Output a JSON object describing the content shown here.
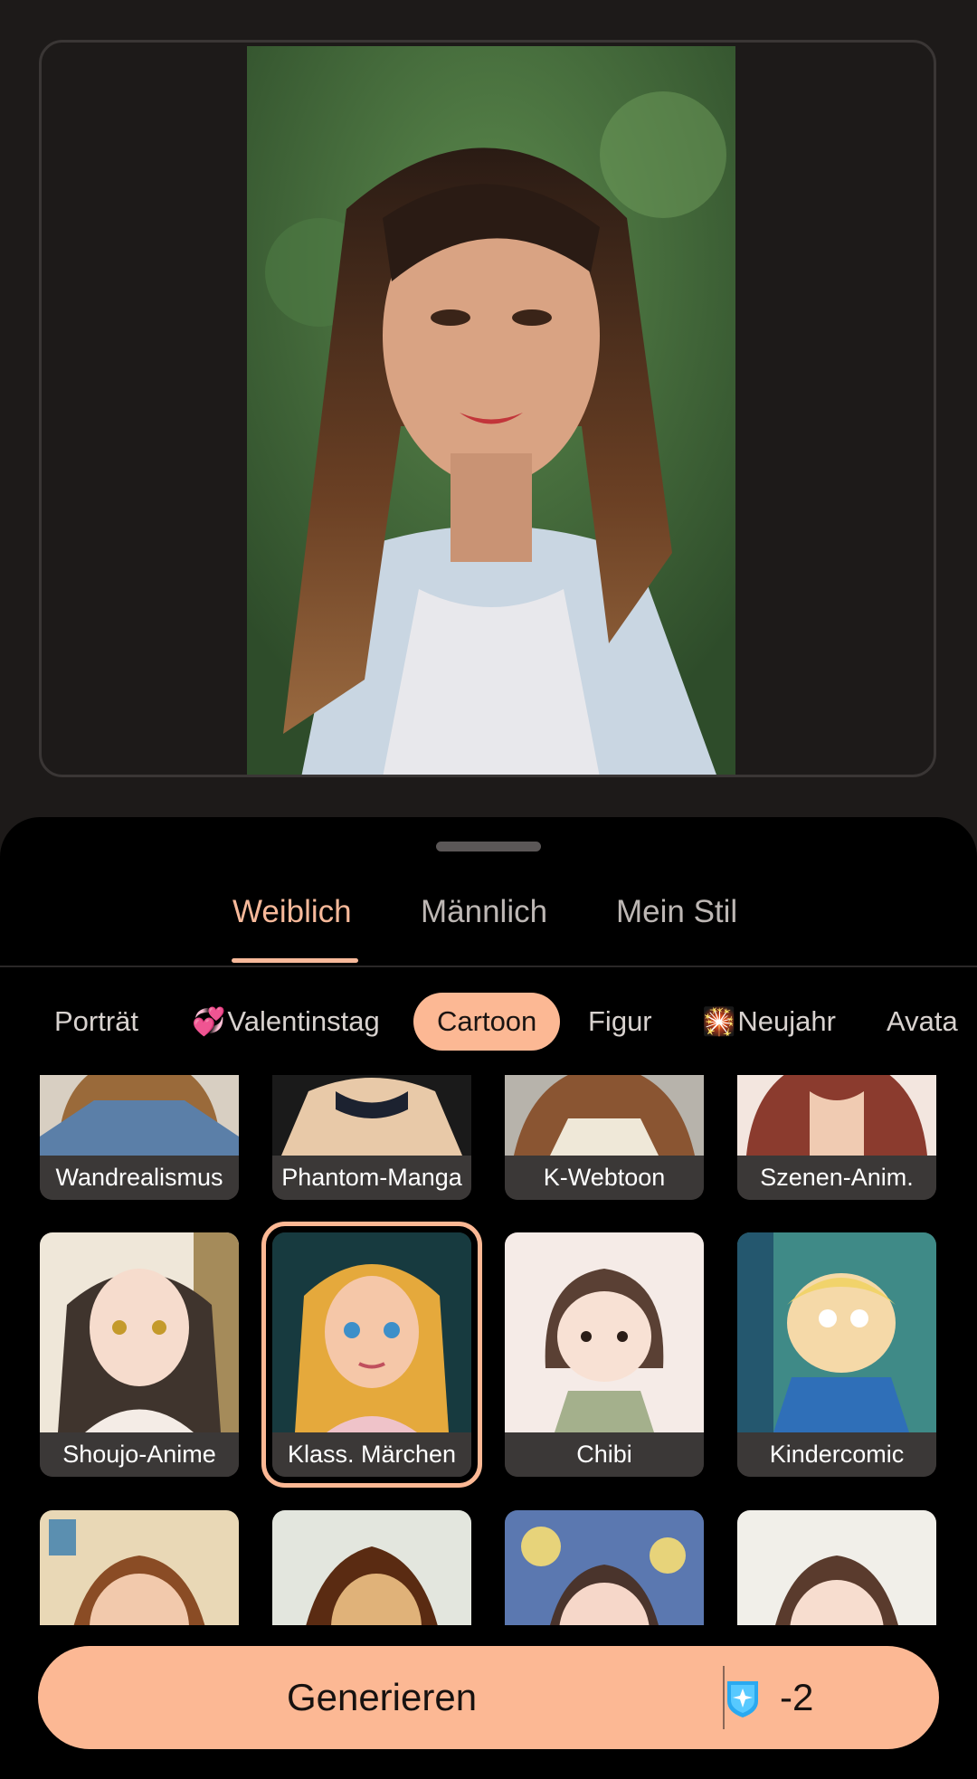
{
  "gender_tabs": [
    "Weiblich",
    "Männlich",
    "Mein Stil"
  ],
  "active_gender_tab": "Weiblich",
  "categories": [
    {
      "emoji": "",
      "label": "Porträt"
    },
    {
      "emoji": "💞",
      "label": "Valentinstag"
    },
    {
      "emoji": "",
      "label": "Cartoon"
    },
    {
      "emoji": "",
      "label": "Figur"
    },
    {
      "emoji": "🎇",
      "label": "Neujahr"
    },
    {
      "emoji": "",
      "label": "Avata"
    }
  ],
  "active_category": "Cartoon",
  "styles_row1": [
    "Wandrealismus",
    "Phantom-Manga",
    "K-Webtoon",
    "Szenen-Anim."
  ],
  "styles_row2": [
    "Shoujo-Anime",
    "Klass. Märchen",
    "Chibi",
    "Kindercomic"
  ],
  "selected_style": "Klass. Märchen",
  "generate": {
    "label": "Generieren",
    "cost": "-2",
    "credit_icon": "credit-gem-icon"
  },
  "colors": {
    "accent": "#fcb894",
    "sheet_bg": "#000000",
    "page_bg": "#1d1a19"
  }
}
